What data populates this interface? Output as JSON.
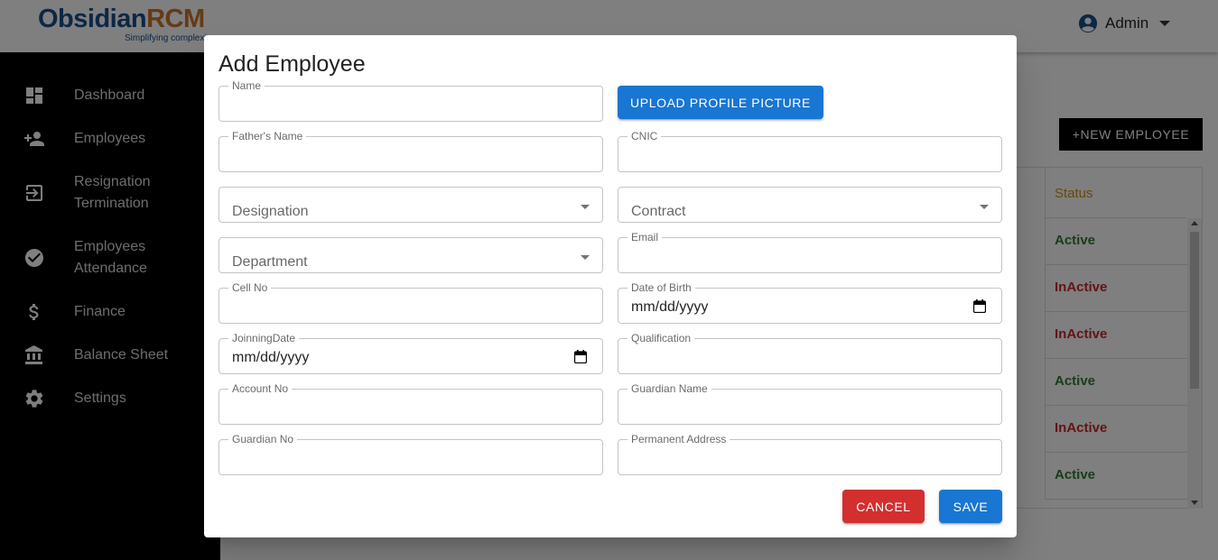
{
  "app": {
    "logo_main_a": "Obsidian",
    "logo_main_b": "RCM",
    "logo_tagline": "Simplifying complexity",
    "user_name": "Admin"
  },
  "sidebar": {
    "items": [
      {
        "label": "Dashboard",
        "icon": "dashboard-icon"
      },
      {
        "label": "Employees",
        "icon": "person-add-icon"
      },
      {
        "label": "Resignation Termination",
        "icon": "exit-icon"
      },
      {
        "label": "Employees Attendance",
        "icon": "check-circle-icon"
      },
      {
        "label": "Finance",
        "icon": "dollar-icon"
      },
      {
        "label": "Balance Sheet",
        "icon": "bank-icon"
      },
      {
        "label": "Settings",
        "icon": "gear-icon"
      }
    ]
  },
  "page": {
    "new_employee_label": "+NEW EMPLOYEE",
    "table_status_header": "Status",
    "statuses": [
      "Active",
      "InActive",
      "InActive",
      "Active",
      "InActive",
      "Active"
    ]
  },
  "dialog": {
    "title": "Add Employee",
    "upload_label": "UPLOAD PROFILE PICTURE",
    "fields": {
      "name": {
        "label": "Name",
        "value": ""
      },
      "fathers_name": {
        "label": "Father's Name",
        "value": ""
      },
      "cnic": {
        "label": "CNIC",
        "value": ""
      },
      "designation": {
        "placeholder": "Designation"
      },
      "contract": {
        "placeholder": "Contract"
      },
      "department": {
        "placeholder": "Department"
      },
      "email": {
        "label": "Email",
        "value": ""
      },
      "cell_no": {
        "label": "Cell No",
        "value": ""
      },
      "date_of_birth": {
        "label": "Date of Birth",
        "value": "mm/dd/yyyy"
      },
      "joining_date": {
        "label": "JoinningDate",
        "value": "mm/dd/yyyy"
      },
      "qualification": {
        "label": "Qualification",
        "value": ""
      },
      "account_no": {
        "label": "Account No",
        "value": ""
      },
      "guardian_name": {
        "label": "Guardian Name",
        "value": ""
      },
      "guardian_no": {
        "label": "Guardian No",
        "value": ""
      },
      "permanent_address": {
        "label": "Permanent Address",
        "value": ""
      }
    },
    "cancel_label": "CANCEL",
    "save_label": "SAVE"
  },
  "colors": {
    "primary": "#1976d2",
    "danger": "#d32f2f",
    "active": "#2e7d32",
    "inactive": "#c62828",
    "status_header": "#c89216",
    "sidebar_bg": "#000000"
  }
}
